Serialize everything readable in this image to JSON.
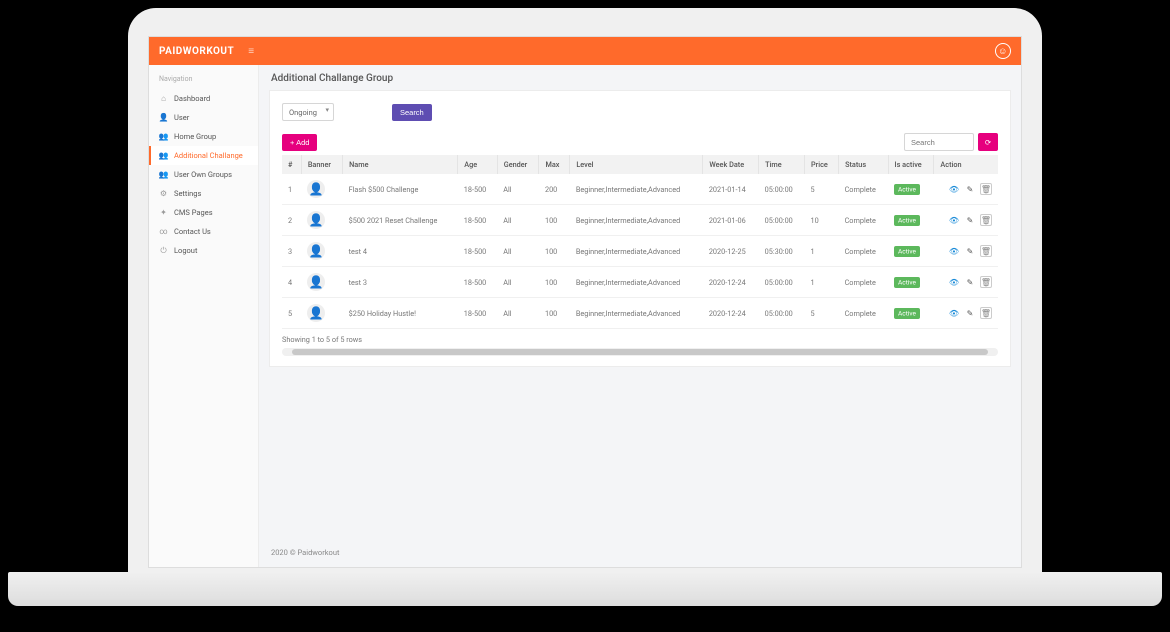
{
  "brand": "PAIDWORKOUT",
  "sidebar": {
    "title": "Navigation",
    "items": [
      {
        "icon": "home-icon",
        "label": "Dashboard"
      },
      {
        "icon": "user-icon",
        "label": "User"
      },
      {
        "icon": "group-icon",
        "label": "Home Group"
      },
      {
        "icon": "group-icon",
        "label": "Additional Challange"
      },
      {
        "icon": "group-icon",
        "label": "User Own Groups"
      },
      {
        "icon": "gear-icon",
        "label": "Settings"
      },
      {
        "icon": "pages-icon",
        "label": "CMS Pages"
      },
      {
        "icon": "link-icon",
        "label": "Contact Us"
      },
      {
        "icon": "power-icon",
        "label": "Logout"
      }
    ],
    "activeIndex": 3
  },
  "page": {
    "title": "Additional Challange Group"
  },
  "filter": {
    "selectValue": "Ongoing",
    "searchBtn": "Search"
  },
  "toolbar": {
    "addLabel": "Add",
    "searchPlaceholder": "Search"
  },
  "table": {
    "columns": [
      "#",
      "Banner",
      "Name",
      "Age",
      "Gender",
      "Max",
      "Level",
      "Week Date",
      "Time",
      "Price",
      "Status",
      "Is active",
      "Action"
    ],
    "rows": [
      {
        "n": "1",
        "name": "Flash $500 Challenge",
        "age": "18-500",
        "gender": "All",
        "max": "200",
        "level": "Beginner,Intermediate,Advanced",
        "date": "2021-01-14",
        "time": "05:00:00",
        "price": "5",
        "status": "Complete",
        "active": "Active"
      },
      {
        "n": "2",
        "name": "$500 2021 Reset Challenge",
        "age": "18-500",
        "gender": "All",
        "max": "100",
        "level": "Beginner,Intermediate,Advanced",
        "date": "2021-01-06",
        "time": "05:00:00",
        "price": "10",
        "status": "Complete",
        "active": "Active"
      },
      {
        "n": "3",
        "name": "test 4",
        "age": "18-500",
        "gender": "All",
        "max": "100",
        "level": "Beginner,Intermediate,Advanced",
        "date": "2020-12-25",
        "time": "05:30:00",
        "price": "1",
        "status": "Complete",
        "active": "Active"
      },
      {
        "n": "4",
        "name": "test 3",
        "age": "18-500",
        "gender": "All",
        "max": "100",
        "level": "Beginner,Intermediate,Advanced",
        "date": "2020-12-24",
        "time": "05:00:00",
        "price": "1",
        "status": "Complete",
        "active": "Active"
      },
      {
        "n": "5",
        "name": "$250 Holiday Hustle!",
        "age": "18-500",
        "gender": "All",
        "max": "100",
        "level": "Beginner,Intermediate,Advanced",
        "date": "2020-12-24",
        "time": "05:00:00",
        "price": "5",
        "status": "Complete",
        "active": "Active"
      }
    ],
    "showing": "Showing 1 to 5 of 5 rows"
  },
  "footer": "2020 © Paidworkout"
}
